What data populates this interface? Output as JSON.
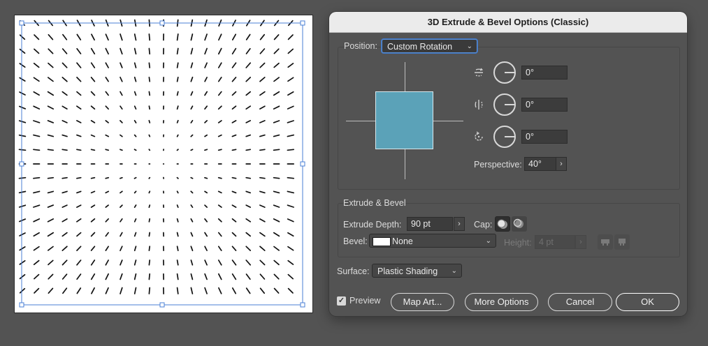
{
  "dialog": {
    "title": "3D Extrude & Bevel Options (Classic)",
    "position": {
      "label": "Position:",
      "value": "Custom Rotation"
    },
    "rotation": {
      "x_angle": "0°",
      "y_angle": "0°",
      "z_angle": "0°",
      "perspective_label": "Perspective:",
      "perspective_value": "40°"
    },
    "extrude_bevel": {
      "section_title": "Extrude & Bevel",
      "depth_label": "Extrude Depth:",
      "depth_value": "90 pt",
      "cap_label": "Cap:",
      "bevel_label": "Bevel:",
      "bevel_value": "None",
      "height_label": "Height:",
      "height_value": "4 pt"
    },
    "surface": {
      "label": "Surface:",
      "value": "Plastic Shading"
    },
    "buttons": {
      "preview": "Preview",
      "preview_checked": true,
      "map_art": "Map Art...",
      "more_options": "More Options",
      "cancel": "Cancel",
      "ok": "OK"
    },
    "cube_color": "#5ba2b8"
  },
  "icons": {
    "x_axis": "x-axis-rotate-icon",
    "y_axis": "y-axis-rotate-icon",
    "z_axis": "z-axis-rotate-icon",
    "cap_on": "cap-on-icon",
    "cap_off": "cap-off-icon",
    "bevel_in": "bevel-in-icon",
    "bevel_out": "bevel-out-icon"
  }
}
